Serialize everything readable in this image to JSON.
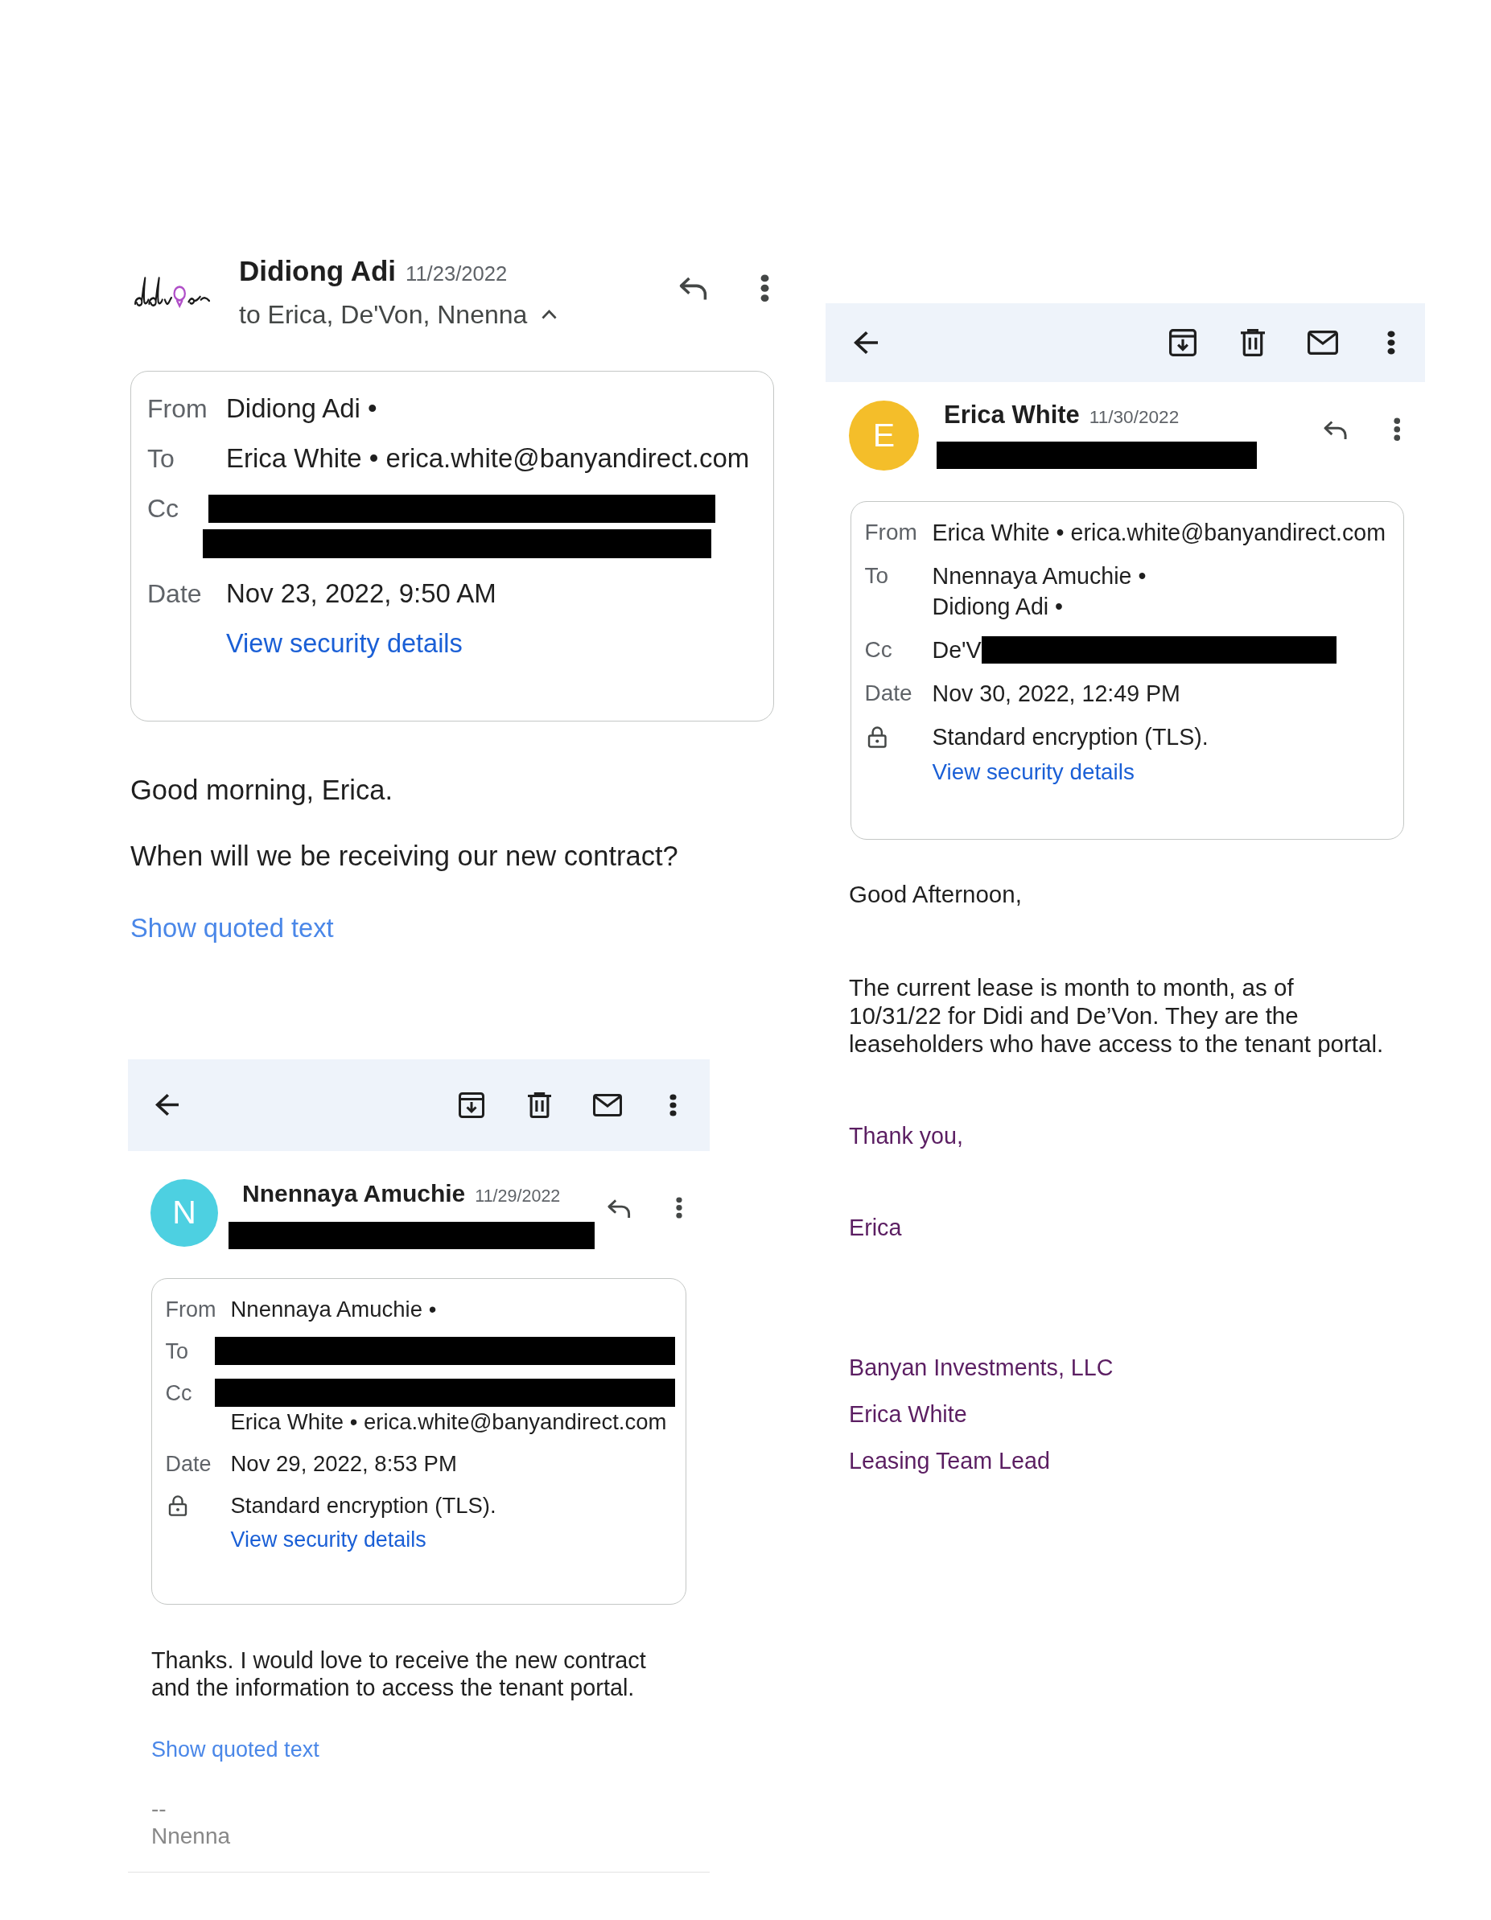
{
  "messages": [
    {
      "avatar": {
        "kind": "logo"
      },
      "sender": "Didiong Adi",
      "date": "11/23/2022",
      "recipients": {
        "text": "to Erica, De'Von, Nnenna",
        "redacted": false,
        "expanded": true
      },
      "details": {
        "rows": [
          {
            "label": "From",
            "lines": [
              {
                "text": "Didiong Adi •",
                "redacted": false
              }
            ]
          },
          {
            "label": "To",
            "lines": [
              {
                "text": "Erica White • erica.white@banyandirect.com",
                "redacted": false
              }
            ]
          },
          {
            "label": "Cc",
            "lines": [
              {
                "redacted": true
              },
              {
                "redacted": true
              }
            ]
          },
          {
            "label": "Date",
            "lines": [
              {
                "text": "Nov 23, 2022, 9:50 AM",
                "redacted": false
              }
            ]
          }
        ],
        "security": {
          "link": "View security details"
        }
      },
      "body": [
        {
          "kind": "text",
          "text": "Good morning, Erica."
        },
        {
          "kind": "text",
          "text": "When will we be receiving our new contract?"
        },
        {
          "kind": "link",
          "text": "Show quoted text"
        }
      ]
    },
    {
      "toolbar": true,
      "avatar": {
        "kind": "letter",
        "letter": "N",
        "color": "#4dd0e1"
      },
      "sender": "Nnennaya Amuchie",
      "date": "11/29/2022",
      "recipients": {
        "redacted": true
      },
      "details": {
        "rows": [
          {
            "label": "From",
            "lines": [
              {
                "text": "Nnennaya Amuchie •",
                "redacted": false
              }
            ]
          },
          {
            "label": "To",
            "lines": [
              {
                "redacted": true
              }
            ]
          },
          {
            "label": "Cc",
            "lines": [
              {
                "redacted": true
              },
              {
                "text": "Erica White • erica.white@banyandirect.com",
                "redacted": false
              }
            ]
          },
          {
            "label": "Date",
            "lines": [
              {
                "text": "Nov 29, 2022, 8:53 PM",
                "redacted": false
              }
            ]
          }
        ],
        "security": {
          "note": "Standard encryption (TLS).",
          "link": "View security details"
        }
      },
      "body": [
        {
          "kind": "text",
          "text": "Thanks. I would love to receive the new contract\nand the information to access the tenant portal."
        },
        {
          "kind": "link",
          "text": "Show quoted text"
        },
        {
          "kind": "signature",
          "text": "--"
        },
        {
          "kind": "signature",
          "text": "Nnenna"
        }
      ]
    },
    {
      "toolbar": true,
      "avatar": {
        "kind": "letter",
        "letter": "E",
        "color": "#f4be2a"
      },
      "sender": "Erica White",
      "date": "11/30/2022",
      "recipients": {
        "redacted": true
      },
      "details": {
        "rows": [
          {
            "label": "From",
            "lines": [
              {
                "text": "Erica White • erica.white@banyandirect.com",
                "redacted": false
              }
            ]
          },
          {
            "label": "To",
            "lines": [
              {
                "text": "Nnennaya Amuchie •",
                "redacted": false
              },
              {
                "text": "Didiong Adi •",
                "redacted": false
              }
            ]
          },
          {
            "label": "Cc",
            "lines": [
              {
                "text": "De'V",
                "redacted": true
              }
            ]
          },
          {
            "label": "Date",
            "lines": [
              {
                "text": "Nov 30, 2022, 12:49 PM",
                "redacted": false
              }
            ]
          }
        ],
        "security": {
          "note": "Standard encryption (TLS).",
          "link": "View security details"
        }
      },
      "body": [
        {
          "kind": "text",
          "text": "Good Afternoon,"
        },
        {
          "kind": "text",
          "text": "The current lease is month to month, as of\n10/31/22 for Didi and De’Von. They are the\nleaseholders who have access to the tenant portal."
        },
        {
          "kind": "closing",
          "text": "Thank you,"
        },
        {
          "kind": "closing",
          "text": "Erica"
        },
        {
          "kind": "closing",
          "text": "Banyan Investments, LLC"
        },
        {
          "kind": "closing",
          "text": "Erica White"
        },
        {
          "kind": "closing",
          "text": "Leasing Team Lead"
        }
      ]
    }
  ]
}
